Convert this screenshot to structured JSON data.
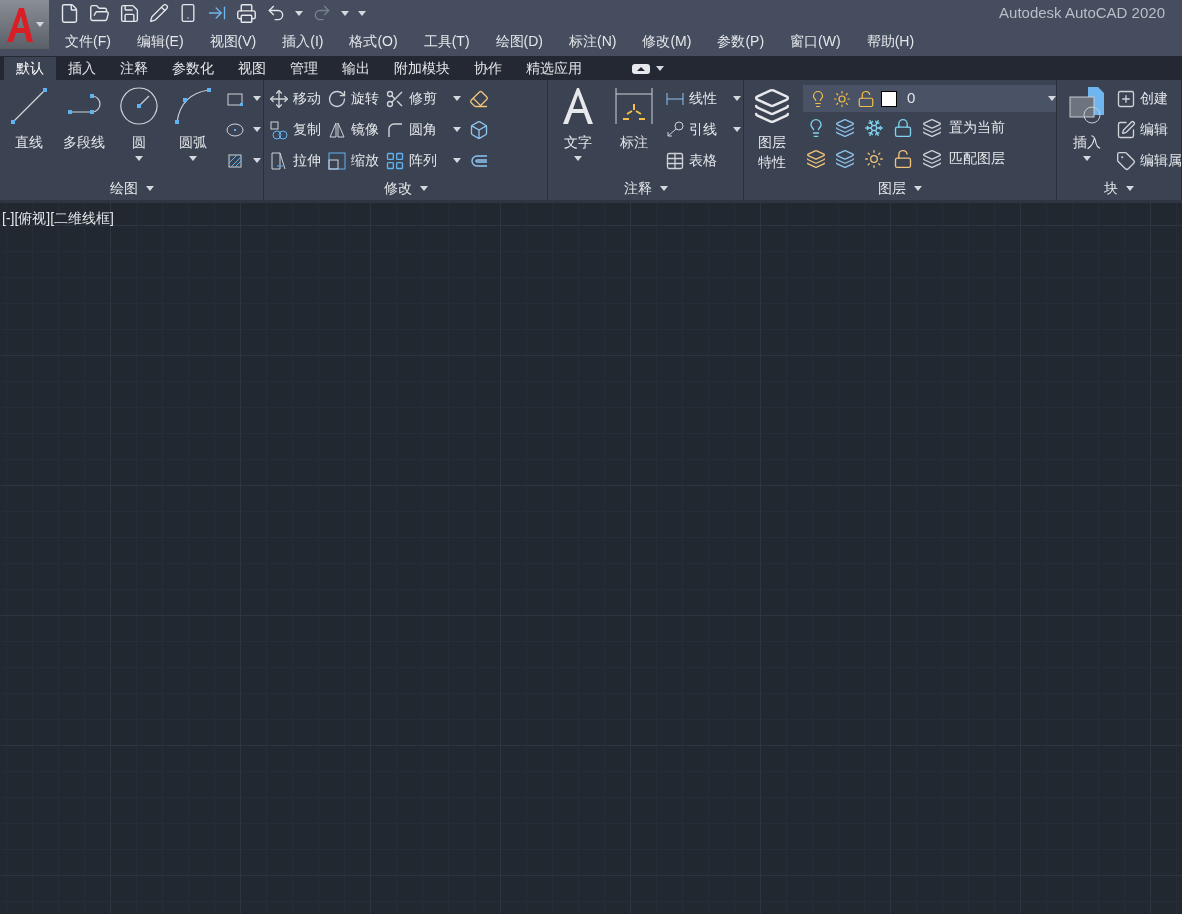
{
  "title": "Autodesk AutoCAD 2020",
  "menu": [
    "文件(F)",
    "编辑(E)",
    "视图(V)",
    "插入(I)",
    "格式(O)",
    "工具(T)",
    "绘图(D)",
    "标注(N)",
    "修改(M)",
    "参数(P)",
    "窗口(W)",
    "帮助(H)"
  ],
  "ribbon_tabs": [
    {
      "label": "默认",
      "selected": true
    },
    {
      "label": "插入",
      "selected": false
    },
    {
      "label": "注释",
      "selected": false
    },
    {
      "label": "参数化",
      "selected": false
    },
    {
      "label": "视图",
      "selected": false
    },
    {
      "label": "管理",
      "selected": false
    },
    {
      "label": "输出",
      "selected": false
    },
    {
      "label": "附加模块",
      "selected": false
    },
    {
      "label": "协作",
      "selected": false
    },
    {
      "label": "精选应用",
      "selected": false
    }
  ],
  "panels": [
    {
      "title": "绘图",
      "columns": [
        {
          "kind": "large",
          "tools": [
            {
              "label": "直线",
              "dropdown": false
            }
          ]
        },
        {
          "kind": "large",
          "tools": [
            {
              "label": "多段线",
              "dropdown": false
            }
          ]
        },
        {
          "kind": "large",
          "tools": [
            {
              "label": "圆",
              "dropdown": true
            }
          ]
        },
        {
          "kind": "large",
          "tools": [
            {
              "label": "圆弧",
              "dropdown": true
            }
          ]
        },
        {
          "kind": "icons",
          "tools": [
            {
              "dropdown": true
            },
            {
              "dropdown": true
            },
            {
              "dropdown": true
            }
          ]
        }
      ]
    },
    {
      "title": "修改",
      "columns": [
        {
          "kind": "small",
          "tools": [
            {
              "label": "移动",
              "dropdown": false
            },
            {
              "label": "复制",
              "dropdown": false
            },
            {
              "label": "拉伸",
              "dropdown": false
            }
          ]
        },
        {
          "kind": "small",
          "tools": [
            {
              "label": "旋转",
              "dropdown": false
            },
            {
              "label": "镜像",
              "dropdown": false
            },
            {
              "label": "缩放",
              "dropdown": false
            }
          ]
        },
        {
          "kind": "small",
          "tools": [
            {
              "label": "修剪",
              "dropdown": true
            },
            {
              "label": "圆角",
              "dropdown": true
            },
            {
              "label": "阵列",
              "dropdown": true
            }
          ]
        },
        {
          "kind": "icons",
          "tools": [
            {
              "dropdown": false
            },
            {
              "dropdown": false
            },
            {
              "dropdown": false
            }
          ]
        }
      ]
    },
    {
      "title": "注释",
      "columns": [
        {
          "kind": "large",
          "tools": [
            {
              "label": "文字",
              "dropdown": true
            }
          ]
        },
        {
          "kind": "large",
          "tools": [
            {
              "label": "标注",
              "dropdown": false
            }
          ]
        },
        {
          "kind": "small",
          "tools": [
            {
              "label": "线性",
              "dropdown": true
            },
            {
              "label": "引线",
              "dropdown": true
            },
            {
              "label": "表格",
              "dropdown": false
            }
          ]
        }
      ]
    },
    {
      "title": "图层",
      "columns": [
        {
          "kind": "tall",
          "tools": [
            {
              "label": "图层特性",
              "dropdown": false
            }
          ]
        },
        {
          "kind": "layers",
          "current": "0",
          "buttons": [
            "置为当前",
            "匹配图层"
          ]
        }
      ]
    },
    {
      "title": "块",
      "columns": [
        {
          "kind": "large",
          "tools": [
            {
              "label": "插入",
              "dropdown": true
            }
          ]
        },
        {
          "kind": "small",
          "tools": [
            {
              "label": "创建"
            },
            {
              "label": "编辑"
            },
            {
              "label": "编辑属"
            }
          ]
        }
      ]
    }
  ],
  "viewport_controls": [
    "[-]",
    "[俯视]",
    "[二维线框]"
  ]
}
